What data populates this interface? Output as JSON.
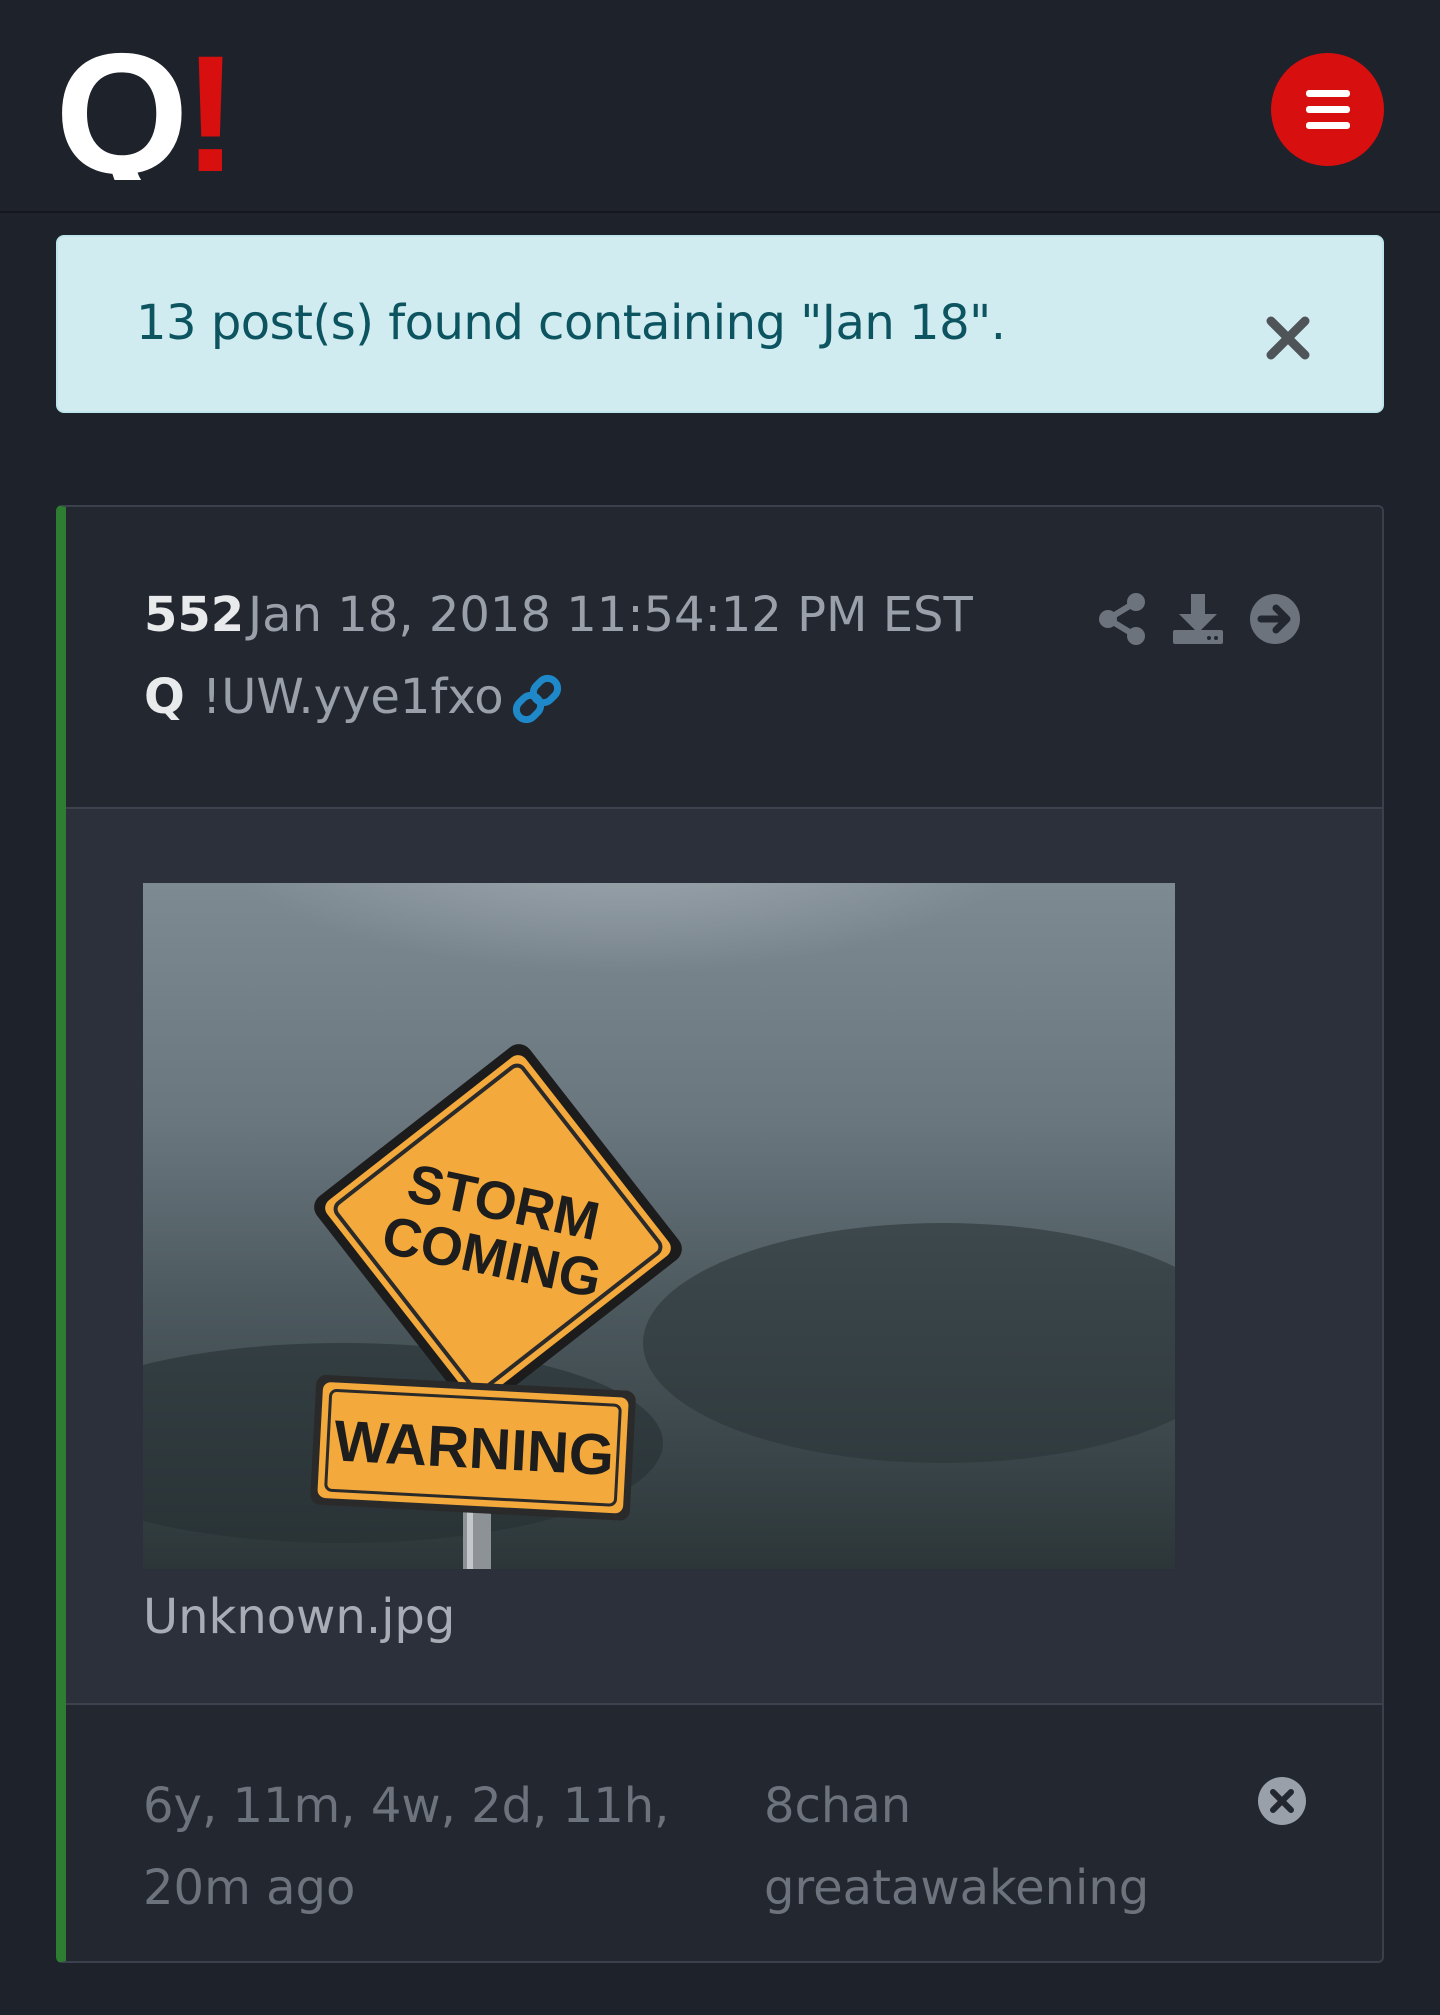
{
  "header": {
    "logo": {
      "letter": "Q",
      "mark": "!",
      "letter_color": "#ffffff",
      "mark_color": "#d70f0f"
    },
    "menu_icon": "hamburger-icon",
    "menu_color": "#d70f0f"
  },
  "alert": {
    "message": "13 post(s) found containing \"Jan 18\".",
    "close_icon": "close-icon"
  },
  "post": {
    "number": "552",
    "date": "Jan 18, 2018 11:54:12 PM EST",
    "author": "Q",
    "tripcode": "!UW.yye1fxo",
    "accent_color": "#2e7d32",
    "link_color": "#1e88c8",
    "icons": [
      "share-icon",
      "download-icon",
      "arrow-right-icon",
      "link-icon"
    ],
    "image": {
      "sign_top_line1": "STORM",
      "sign_top_line2": "COMING",
      "sign_bottom": "WARNING"
    },
    "filename": "Unknown.jpg",
    "elapsed": "6y, 11m, 4w, 2d, 11h, 20m ago",
    "source": "8chan greatawakening",
    "footer_icon": "close-circle-icon"
  }
}
